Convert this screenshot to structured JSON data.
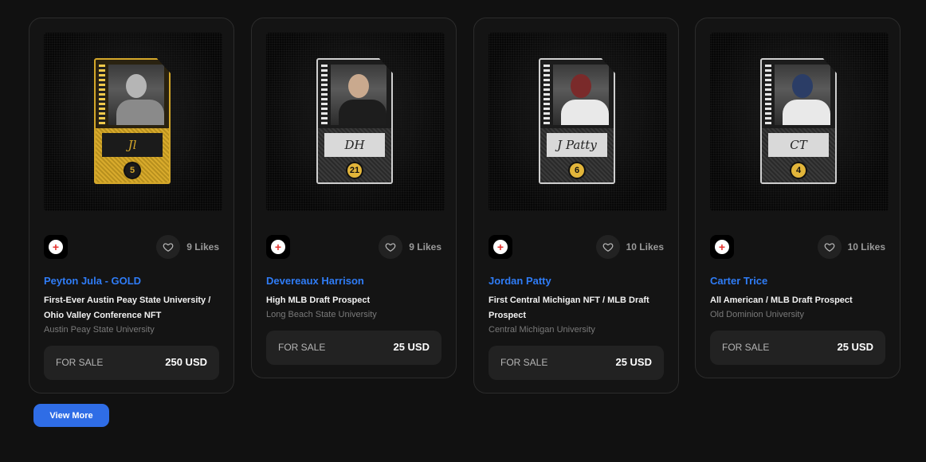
{
  "cards": [
    {
      "name": "Peyton Jula - GOLD",
      "description": "First-Ever Austin Peay State University / Ohio Valley Conference NFT",
      "school": "Austin Peay State University",
      "likes": "9 Likes",
      "sale_label": "FOR SALE",
      "price": "250 USD",
      "jersey": "5",
      "signature": "Jl",
      "variant": "gold"
    },
    {
      "name": "Devereaux Harrison",
      "description": "High MLB Draft Prospect",
      "school": "Long Beach State University",
      "likes": "9 Likes",
      "sale_label": "FOR SALE",
      "price": "25 USD",
      "jersey": "21",
      "signature": "DH",
      "variant": "silver"
    },
    {
      "name": "Jordan Patty",
      "description": "First Central Michigan NFT / MLB Draft Prospect",
      "school": "Central Michigan University",
      "likes": "10 Likes",
      "sale_label": "FOR SALE",
      "price": "25 USD",
      "jersey": "6",
      "signature": "J Patty",
      "variant": "silver"
    },
    {
      "name": "Carter Trice",
      "description": "All American / MLB Draft Prospect",
      "school": "Old Dominion University",
      "likes": "10 Likes",
      "sale_label": "FOR SALE",
      "price": "25 USD",
      "jersey": "4",
      "signature": "CT",
      "variant": "silver"
    }
  ],
  "view_more_label": "View More",
  "colors": {
    "accent": "#2f7cf6",
    "button": "#2f6de6",
    "gold": "#d4a72a",
    "background": "#111111"
  }
}
